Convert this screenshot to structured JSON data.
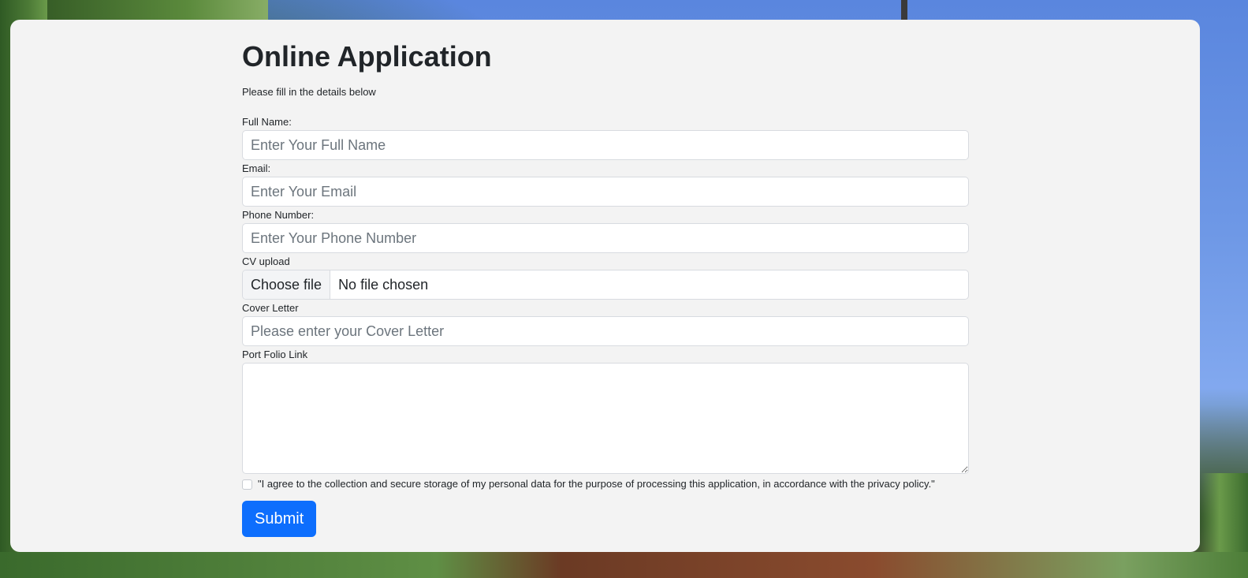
{
  "form": {
    "title": "Online Application",
    "subtitle": "Please fill in the details below",
    "full_name": {
      "label": "Full Name:",
      "placeholder": "Enter Your Full Name"
    },
    "email": {
      "label": "Email:",
      "placeholder": "Enter Your Email"
    },
    "phone": {
      "label": "Phone Number:",
      "placeholder": "Enter Your Phone Number"
    },
    "cv": {
      "label": "CV upload",
      "button": "Choose file",
      "status": "No file chosen"
    },
    "cover_letter": {
      "label": "Cover Letter",
      "placeholder": "Please enter your Cover Letter"
    },
    "portfolio": {
      "label": "Port Folio Link"
    },
    "consent": "\"I agree to the collection and secure storage of my personal data for the purpose of processing this application, in accordance with the privacy policy.\"",
    "submit": "Submit"
  },
  "colors": {
    "primary": "#0d6efd",
    "card_bg": "#f3f3f3"
  }
}
